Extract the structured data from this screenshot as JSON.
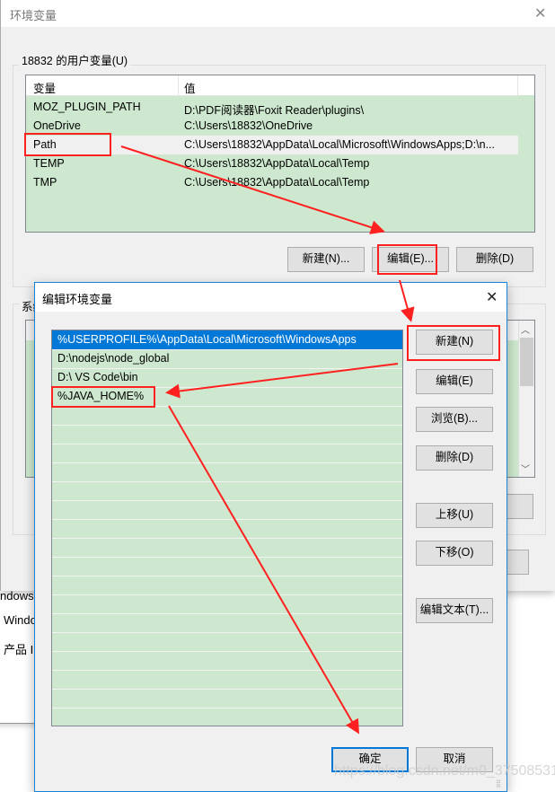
{
  "background_window": {
    "lines": [
      "ndows",
      "Windo",
      "产品 I"
    ]
  },
  "outer_dialog": {
    "title": "环境变量",
    "close_icon": "close-icon",
    "user_vars_group_label": "18832 的用户变量(U)",
    "columns": [
      "变量",
      "值"
    ],
    "rows": [
      {
        "name": "MOZ_PLUGIN_PATH",
        "value": "D:\\PDF阅读器\\Foxit Reader\\plugins\\"
      },
      {
        "name": "OneDrive",
        "value": "C:\\Users\\18832\\OneDrive"
      },
      {
        "name": "Path",
        "value": "C:\\Users\\18832\\AppData\\Local\\Microsoft\\WindowsApps;D:\\n..."
      },
      {
        "name": "TEMP",
        "value": "C:\\Users\\18832\\AppData\\Local\\Temp"
      },
      {
        "name": "TMP",
        "value": "C:\\Users\\18832\\AppData\\Local\\Temp"
      }
    ],
    "selected_row": "Path",
    "buttons": {
      "new": "新建(N)...",
      "edit": "编辑(E)...",
      "delete": "删除(D)"
    },
    "system_vars_group_label": "系统变量(S)"
  },
  "edit_dialog": {
    "title": "编辑环境变量",
    "close_icon": "close-icon",
    "entries": [
      "%USERPROFILE%\\AppData\\Local\\Microsoft\\WindowsApps",
      "D:\\nodejs\\node_global",
      "D:\\ VS Code\\bin",
      "%JAVA_HOME%"
    ],
    "selected_entry": "%USERPROFILE%\\AppData\\Local\\Microsoft\\WindowsApps",
    "buttons": {
      "new": "新建(N)",
      "edit": "编辑(E)",
      "browse": "浏览(B)...",
      "delete": "删除(D)",
      "move_up": "上移(U)",
      "move_down": "下移(O)",
      "edit_text": "编辑文本(T)...",
      "ok": "确定",
      "cancel": "取消"
    }
  },
  "annotations": {
    "color": "#ff2020"
  },
  "watermark": "https://blog.csdn.net/m0_37508531"
}
